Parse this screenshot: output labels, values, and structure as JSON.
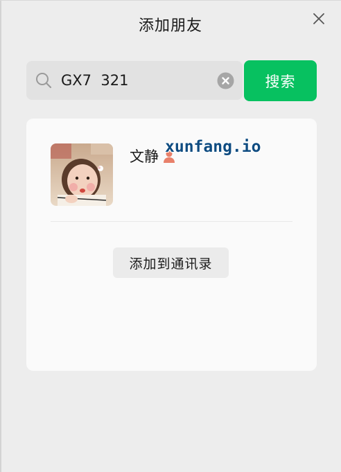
{
  "window": {
    "title": "添加朋友"
  },
  "search": {
    "value": "GX7  321",
    "button_label": "搜索"
  },
  "result": {
    "nickname": "文静",
    "watermark": "xunfang.io",
    "add_button_label": "添加到通讯录",
    "gender_icon": "person-female-icon",
    "gender_color": "#e8806a"
  },
  "colors": {
    "accent": "#07c160",
    "background": "#ededed",
    "card": "#fafafa"
  }
}
